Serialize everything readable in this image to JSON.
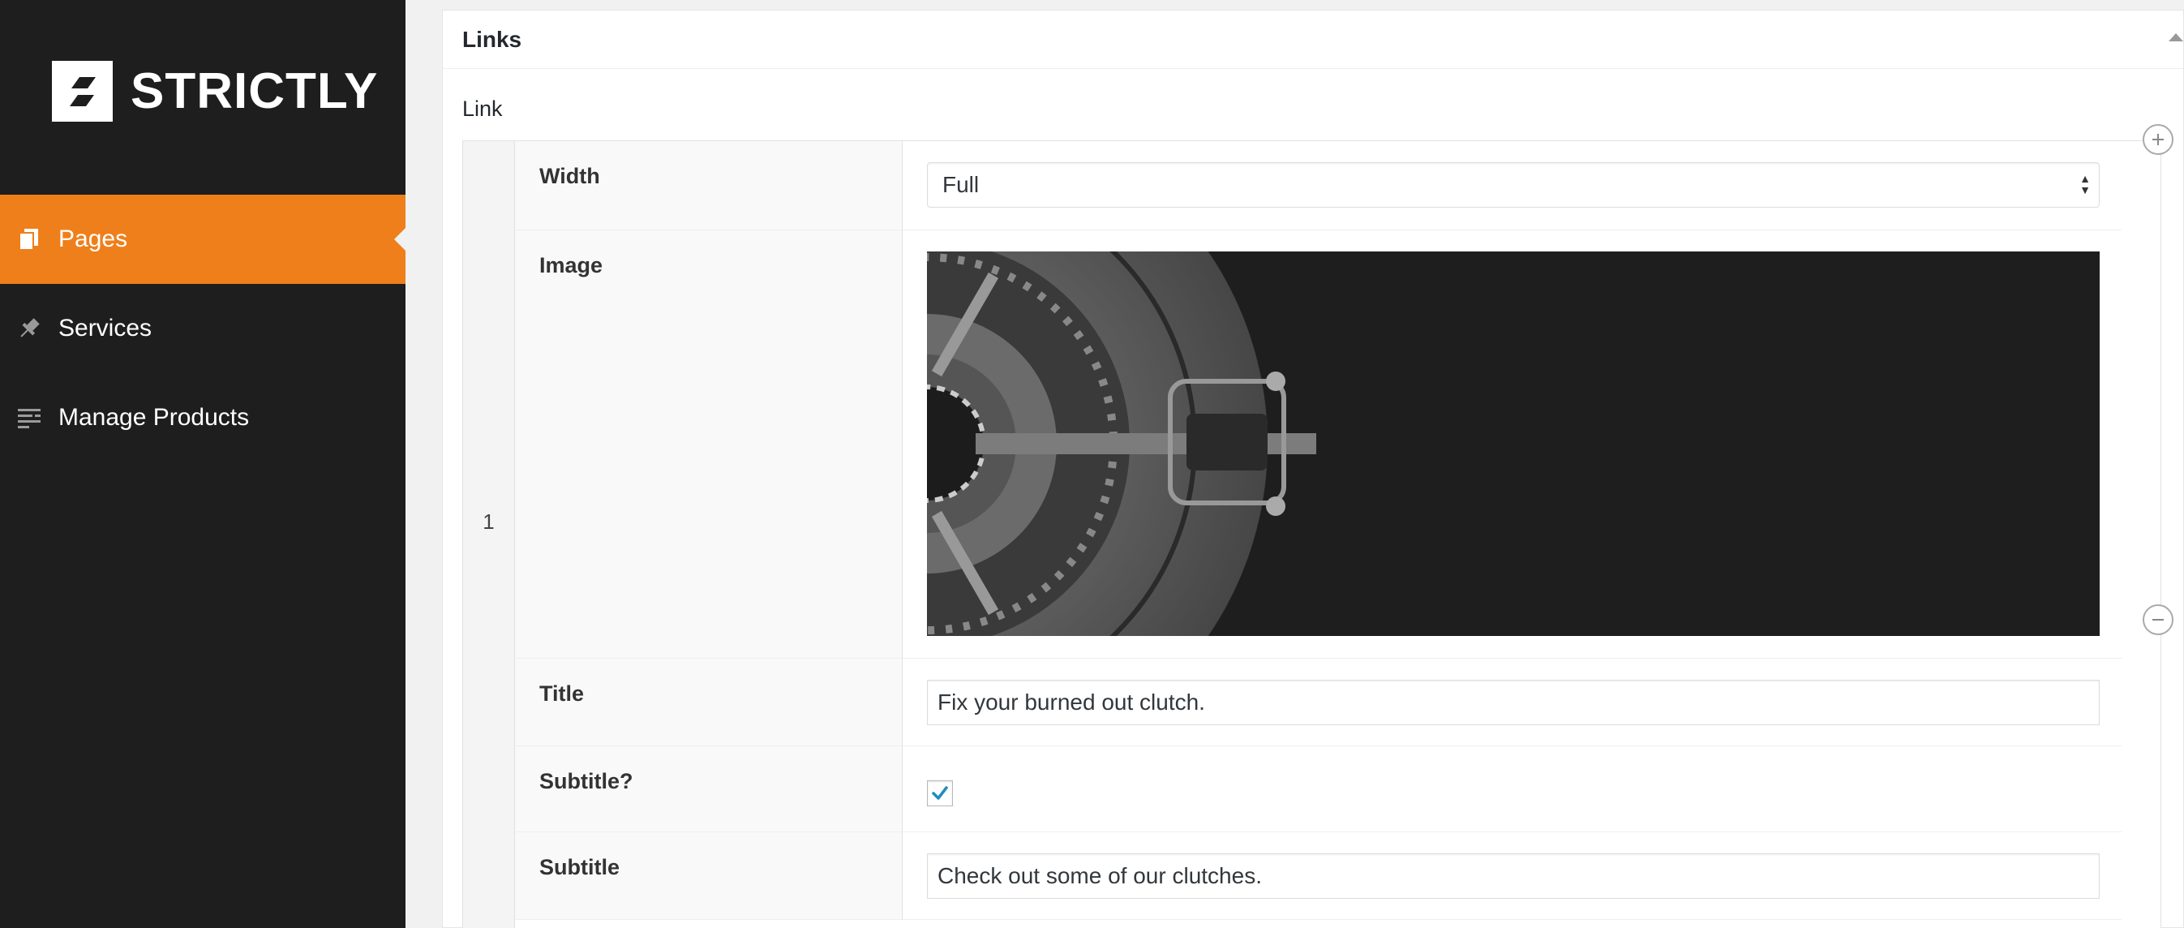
{
  "brand": {
    "name": "STRICTLY",
    "icon": "strictly-logo-mark",
    "accent": "#ef7f1a"
  },
  "sidebar": {
    "items": [
      {
        "label": "Pages",
        "icon": "pages-icon",
        "active": true
      },
      {
        "label": "Services",
        "icon": "pin-icon",
        "active": false
      },
      {
        "label": "Manage Products",
        "icon": "list-icon",
        "active": false
      }
    ]
  },
  "panel": {
    "title": "Links",
    "field_label": "Link",
    "row_number": "1",
    "rows": {
      "width": {
        "label": "Width",
        "value": "Full"
      },
      "image": {
        "label": "Image",
        "alt": "clutch-plate-image"
      },
      "title": {
        "label": "Title",
        "value": "Fix your burned out clutch."
      },
      "subtitle_toggle": {
        "label": "Subtitle?",
        "checked": true
      },
      "subtitle": {
        "label": "Subtitle",
        "value": "Check out some of our clutches."
      }
    }
  }
}
